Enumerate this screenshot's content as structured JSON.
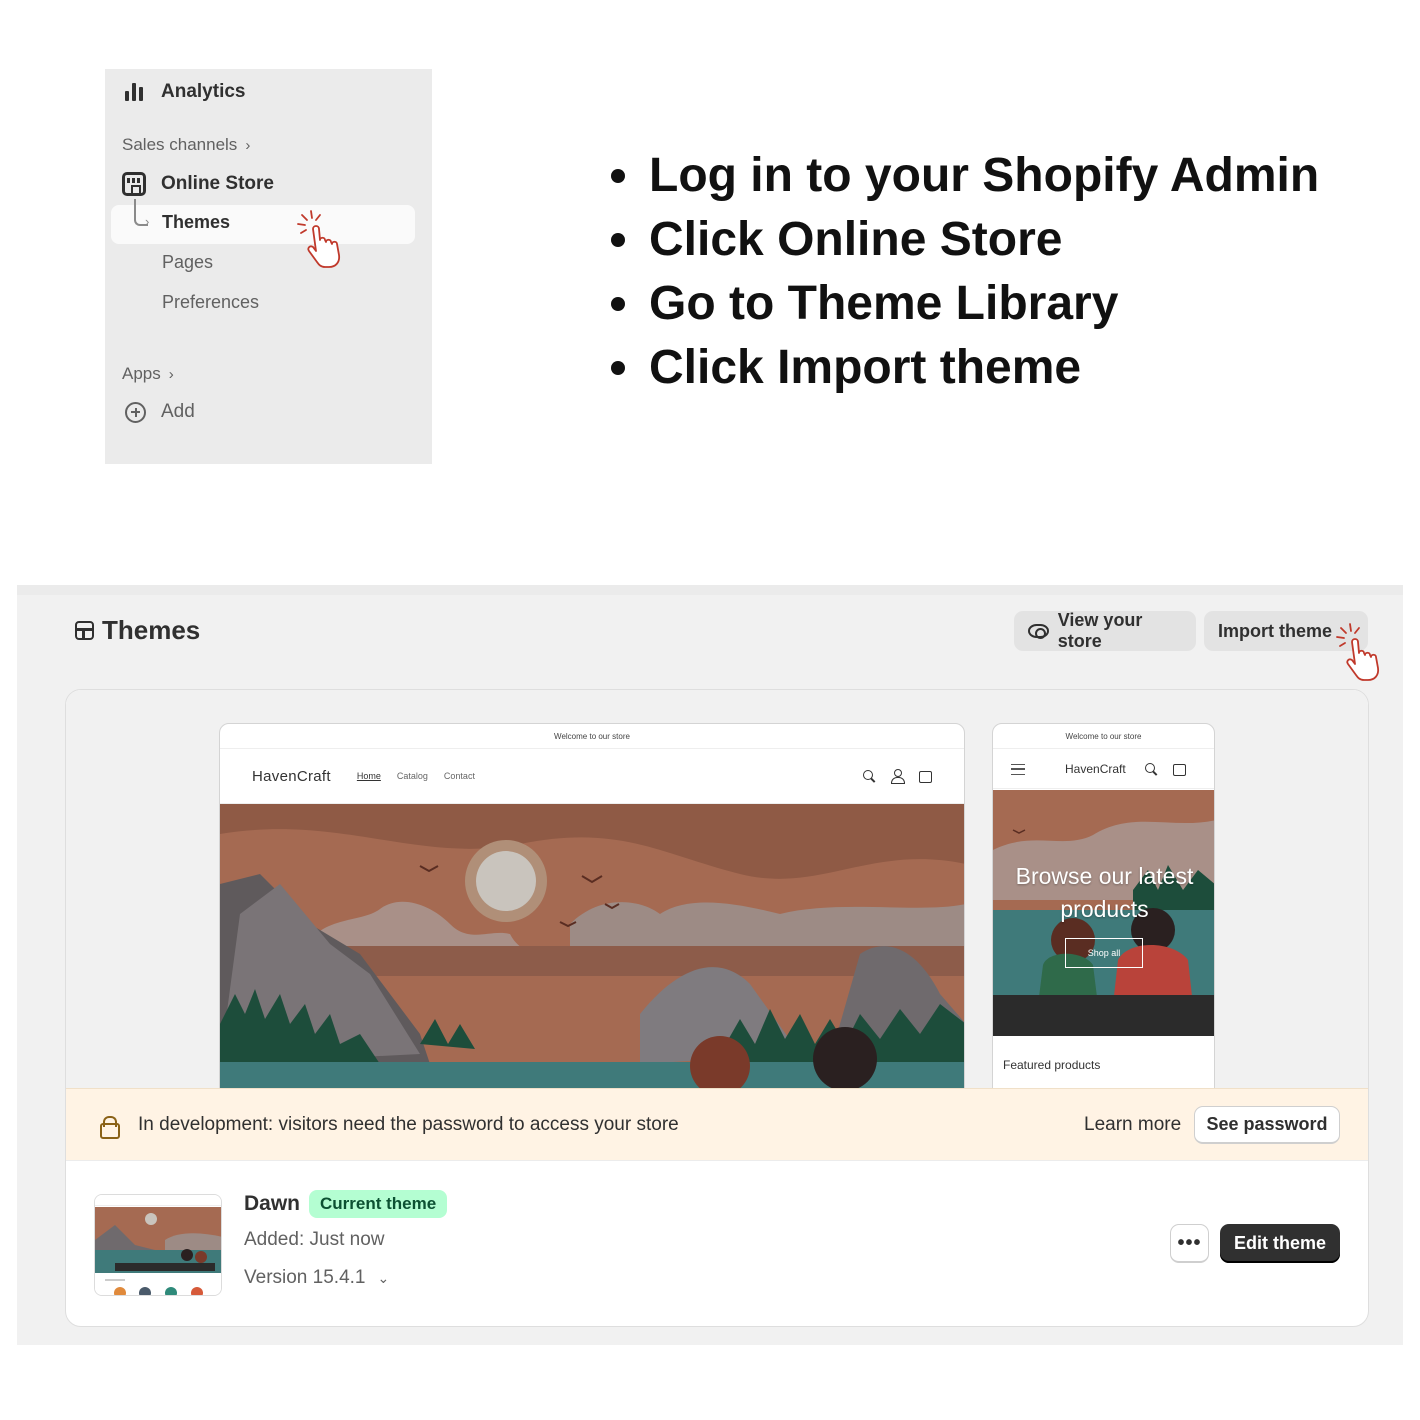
{
  "sidebar": {
    "analytics": "Analytics",
    "sales_channels": "Sales channels",
    "online_store": "Online Store",
    "themes": "Themes",
    "pages": "Pages",
    "preferences": "Preferences",
    "apps": "Apps",
    "add": "Add",
    "chevron": "›"
  },
  "steps": [
    "Log in to your Shopify Admin",
    "Click Online Store",
    "Go to Theme Library",
    "Click Import theme"
  ],
  "admin": {
    "title": "Themes",
    "view_store": "View your store",
    "import_theme": "Import theme"
  },
  "preview": {
    "announcement": "Welcome to our store",
    "brand": "HavenCraft",
    "nav": [
      "Home",
      "Catalog",
      "Contact"
    ],
    "mobile_hero": "Browse our latest products",
    "shop_all": "Shop all",
    "featured": "Featured products"
  },
  "banner": {
    "text": "In development: visitors need the password to access your store",
    "learn_more": "Learn more",
    "see_password": "See password"
  },
  "theme": {
    "name": "Dawn",
    "badge": "Current theme",
    "added": "Added: Just now",
    "version": "Version 15.4.1",
    "edit": "Edit theme",
    "more": "•••"
  },
  "colors": {
    "accent_red": "#c0392b",
    "badge_bg": "#b4fed2",
    "banner_bg": "#fff3e4",
    "primary_button": "#303030"
  }
}
